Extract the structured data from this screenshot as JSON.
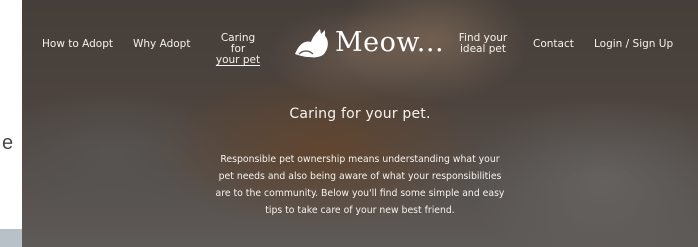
{
  "left_strip": {
    "partial_text": "e"
  },
  "nav": {
    "how_to_adopt": "How to Adopt",
    "why_adopt": "Why Adopt",
    "caring_line1": "Caring for",
    "caring_line2": "your pet",
    "find_line1": "Find your",
    "find_line2": "ideal pet",
    "contact": "Contact",
    "login": "Login / Sign Up"
  },
  "logo": {
    "icon": "cat-icon",
    "text": "Meow..."
  },
  "hero": {
    "heading": "Caring for your pet.",
    "body_lines": [
      "Responsible pet ownership means understanding what your",
      "pet needs and also being aware of what your responsibilities",
      "are to the community. Below you'll find some simple and easy",
      "tips to take care of your new best friend."
    ]
  },
  "colors": {
    "text": "#f4f1ee",
    "overlay": "rgba(20,16,14,0.45)"
  }
}
